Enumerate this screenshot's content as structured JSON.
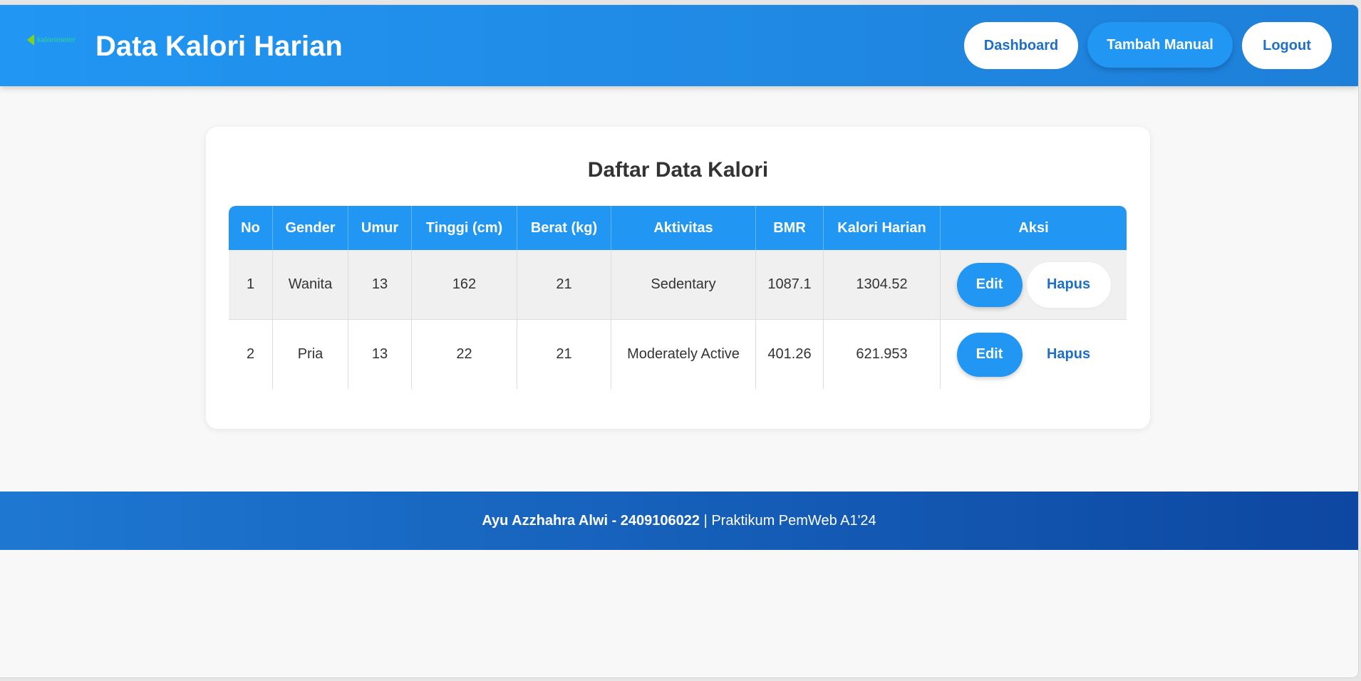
{
  "header": {
    "logo_text": "kalorimeter",
    "title": "Data Kalori Harian",
    "nav": {
      "dashboard": "Dashboard",
      "tambah_manual": "Tambah Manual",
      "logout": "Logout"
    }
  },
  "card": {
    "title": "Daftar Data Kalori",
    "columns": [
      "No",
      "Gender",
      "Umur",
      "Tinggi (cm)",
      "Berat (kg)",
      "Aktivitas",
      "BMR",
      "Kalori Harian",
      "Aksi"
    ],
    "rows": [
      {
        "no": "1",
        "gender": "Wanita",
        "umur": "13",
        "tinggi": "162",
        "berat": "21",
        "aktivitas": "Sedentary",
        "bmr": "1087.1",
        "kalori": "1304.52",
        "edit": "Edit",
        "hapus": "Hapus"
      },
      {
        "no": "2",
        "gender": "Pria",
        "umur": "13",
        "tinggi": "22",
        "berat": "21",
        "aktivitas": "Moderately Active",
        "bmr": "401.26",
        "kalori": "621.953",
        "edit": "Edit",
        "hapus": "Hapus"
      }
    ]
  },
  "footer": {
    "author": "Ayu Azzhahra Alwi - 2409106022",
    "separator": " | ",
    "course": "Praktikum PemWeb A1'24"
  },
  "colors": {
    "primary": "#2196f3",
    "link": "#1e6fc9",
    "footer_end": "#0d47a1"
  }
}
